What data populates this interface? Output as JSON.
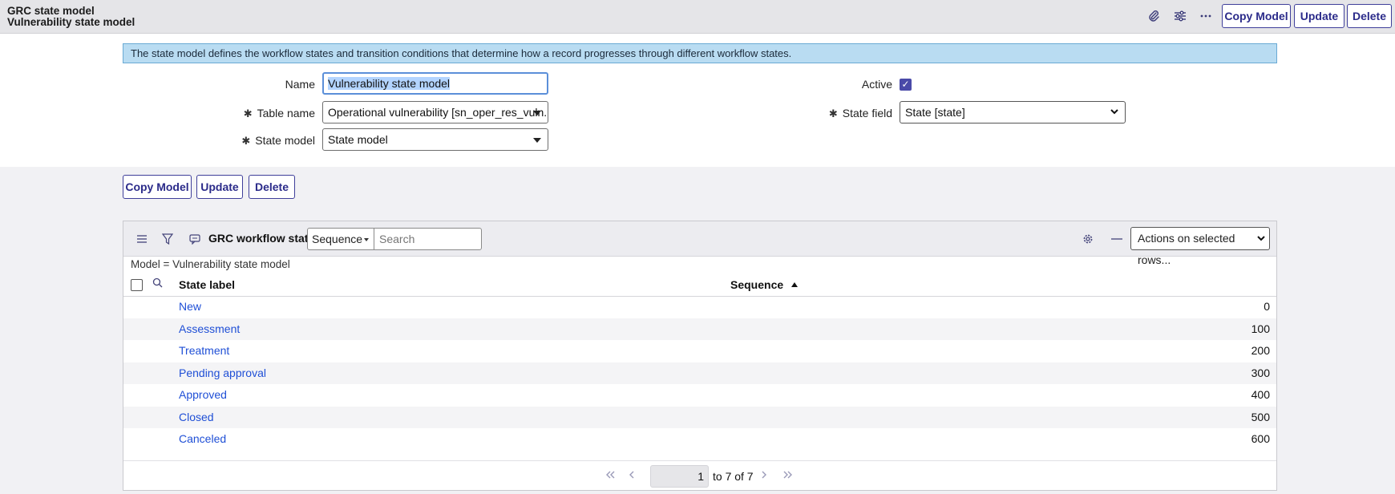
{
  "header": {
    "title_line1": "GRC state model",
    "title_line2": "Vulnerability state model",
    "copy_model": "Copy Model",
    "update": "Update",
    "delete": "Delete"
  },
  "banner": "The state model defines the workflow states and transition conditions that determine how a record progresses through different workflow states.",
  "form": {
    "name_label": "Name",
    "name_value": "Vulnerability state model",
    "table_label": "Table name",
    "table_value": "Operational vulnerability [sn_oper_res_vuln...",
    "state_model_label": "State model",
    "state_model_value": "State model",
    "active_label": "Active",
    "active_checked": true,
    "state_field_label": "State field",
    "state_field_value": "State [state]"
  },
  "form_buttons": {
    "copy_model": "Copy Model",
    "update": "Update",
    "delete": "Delete"
  },
  "list": {
    "title": "GRC workflow states",
    "sort_field": "Sequence",
    "search_placeholder": "Search",
    "actions": "Actions on selected rows...",
    "breadcrumb": "Model = Vulnerability state model",
    "columns": [
      "State label",
      "Sequence"
    ],
    "rows": [
      {
        "label": "New",
        "sequence": "0"
      },
      {
        "label": "Assessment",
        "sequence": "100"
      },
      {
        "label": "Treatment",
        "sequence": "200"
      },
      {
        "label": "Pending approval",
        "sequence": "300"
      },
      {
        "label": "Approved",
        "sequence": "400"
      },
      {
        "label": "Closed",
        "sequence": "500"
      },
      {
        "label": "Canceled",
        "sequence": "600"
      }
    ],
    "pager": {
      "current_page": "1",
      "range_text": "to 7 of 7"
    }
  }
}
